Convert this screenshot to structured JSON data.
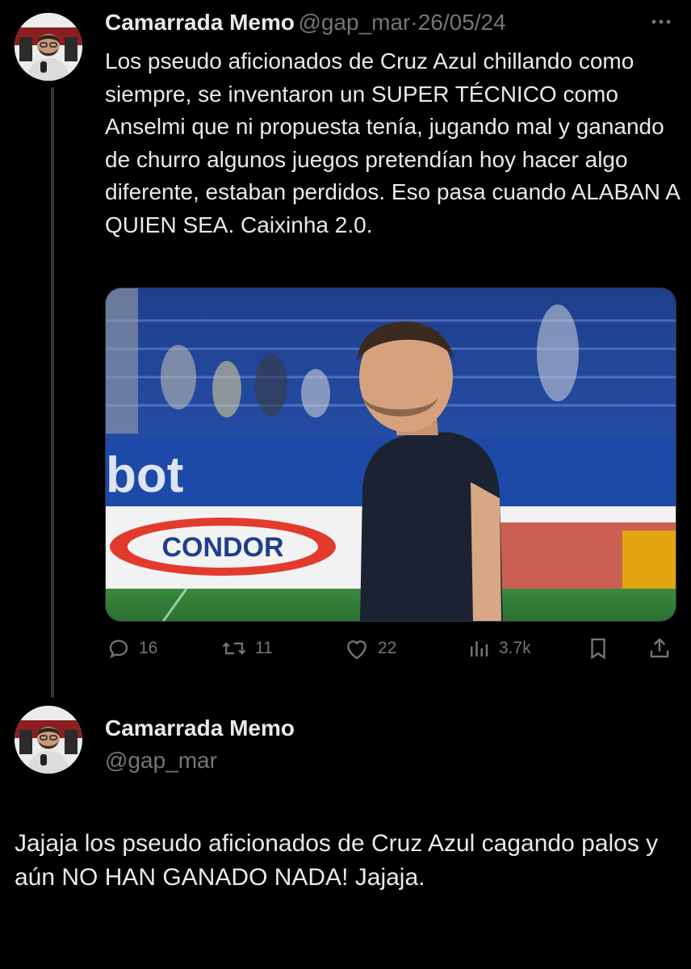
{
  "tweet1": {
    "author_name": "Camarrada Memo",
    "handle": "@gap_mar",
    "separator": "·",
    "date": "26/05/24",
    "more_icon": "more-dots-icon",
    "text": "Los pseudo aficionados de Cruz Azul chillando como siempre, se inventaron un SUPER TÉCNICO como Anselmi que ni propuesta tenía, jugando mal y ganando de churro algunos juegos pretendían hoy hacer algo diferente, estaban perdidos. Eso pasa cuando ALABAN A QUIEN SEA. Caixinha 2.0.",
    "media": {
      "banner_text": "bot",
      "ad_text": "CONDOR"
    },
    "actions": {
      "replies": "16",
      "retweets": "11",
      "likes": "22",
      "views": "3.7k"
    }
  },
  "tweet2": {
    "author_name": "Camarrada Memo",
    "handle": "@gap_mar",
    "text": "Jajaja los pseudo aficionados de Cruz Azul cagando palos y aún NO HAN GANADO NADA! Jajaja."
  },
  "colors": {
    "background": "#000000",
    "text": "#e7e9ea",
    "muted": "#71767b",
    "divider": "#333639"
  }
}
